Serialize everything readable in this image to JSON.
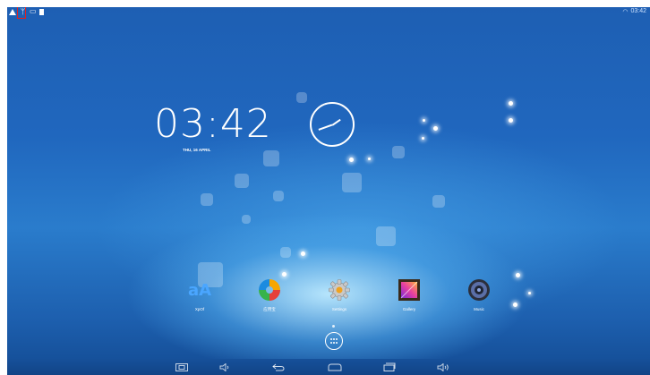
{
  "status_bar": {
    "left_icons": [
      "warning-icon",
      "usb-icon",
      "sd-card-icon",
      "storage-icon"
    ],
    "right": {
      "wifi_icon": "wifi-icon",
      "time": "03:42"
    }
  },
  "clock_widget": {
    "time": "03:42",
    "date": "THU, 16 APRIL"
  },
  "apps": [
    {
      "label": "XpOf",
      "icon": "font-aa-icon"
    },
    {
      "label": "应用宝",
      "icon": "app-store-icon"
    },
    {
      "label": "Settings",
      "icon": "gear-icon"
    },
    {
      "label": "Gallery",
      "icon": "gallery-icon"
    },
    {
      "label": "Music",
      "icon": "speaker-icon"
    }
  ],
  "navigation": {
    "buttons": [
      "screenshot-icon",
      "volume-down-icon",
      "back-icon",
      "home-icon",
      "recent-apps-icon",
      "volume-up-icon"
    ]
  },
  "colors": {
    "wallpaper": "#1e5fb3",
    "highlight_box": "#e02020"
  }
}
